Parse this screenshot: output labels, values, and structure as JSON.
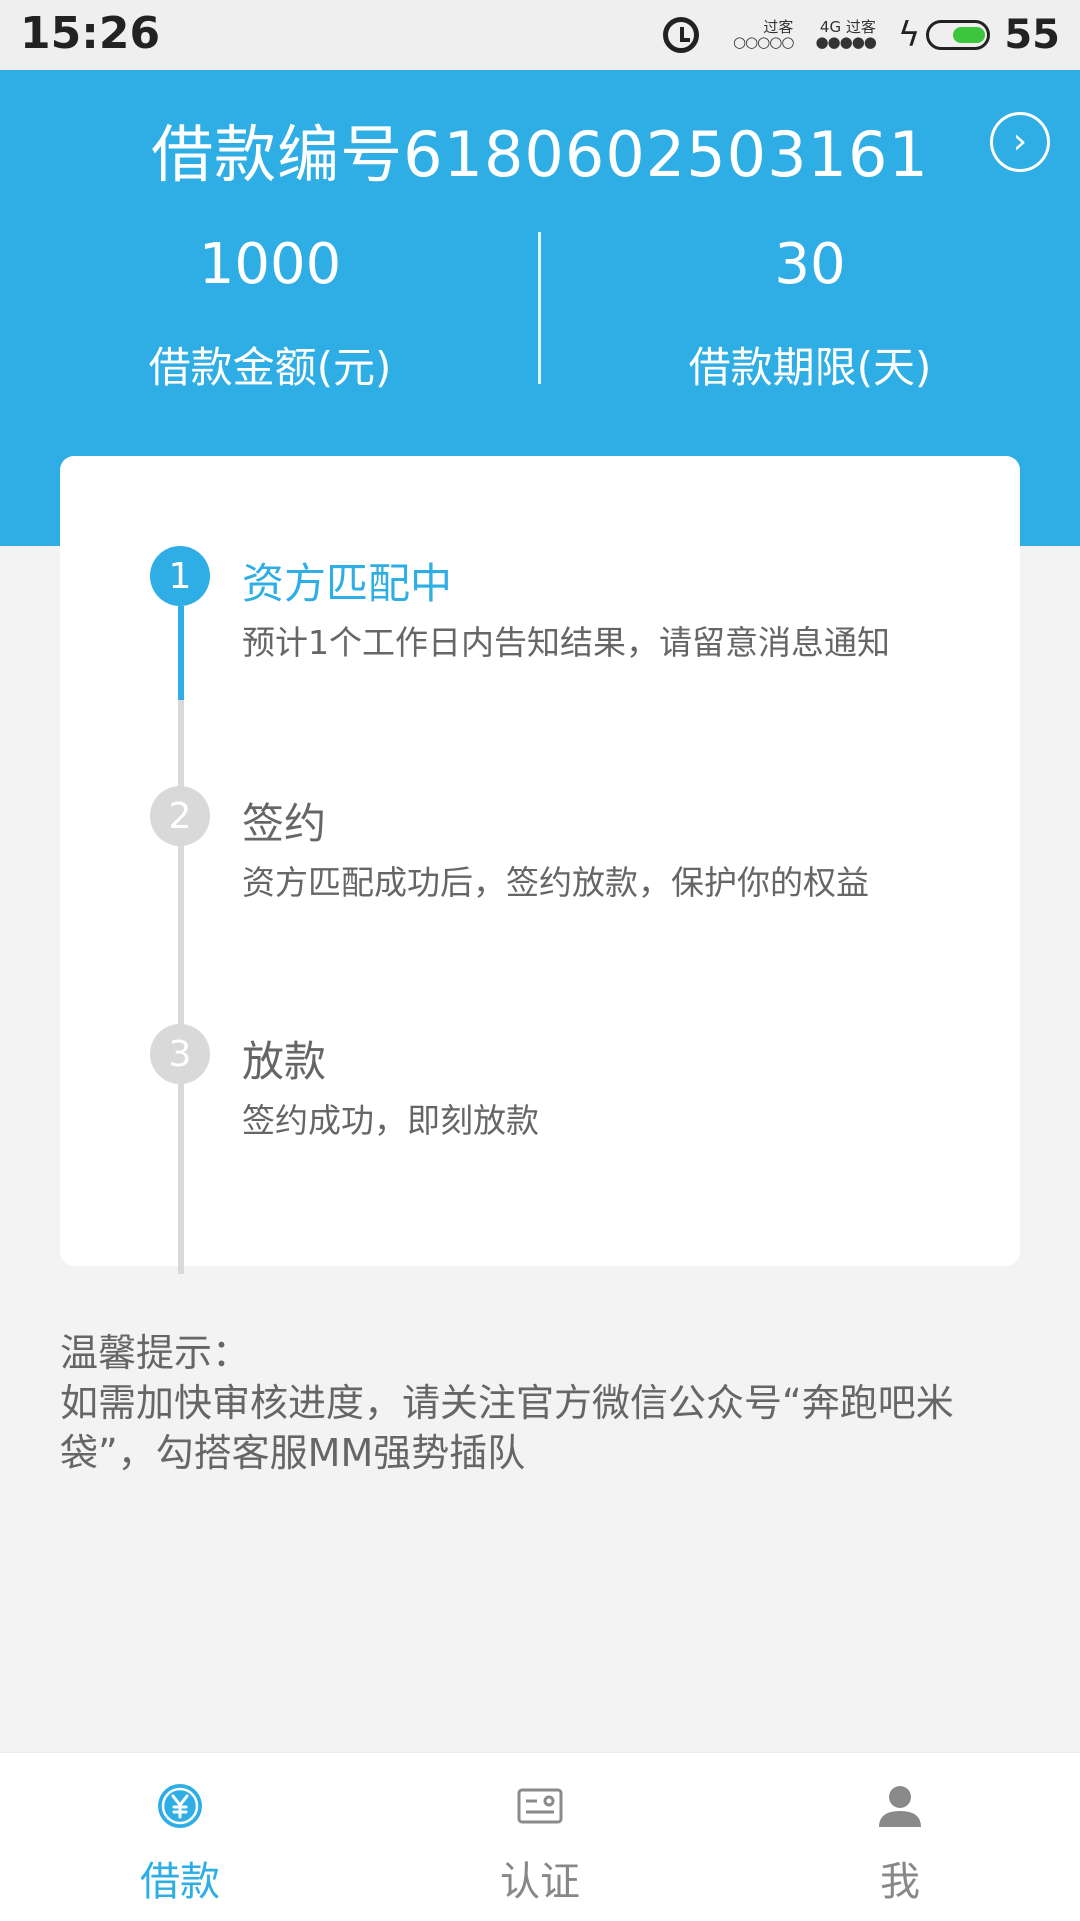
{
  "status_bar": {
    "time": "15:26",
    "sim1_label": "过客",
    "sim1_signal": "○○○○○",
    "sim2_network": "4G",
    "sim2_label": "过客",
    "sim2_signal": "●●●●●",
    "battery_level": "55"
  },
  "loan": {
    "title": "借款编号6180602503161",
    "amount_value": "1000",
    "amount_label": "借款金额(元)",
    "term_value": "30",
    "term_label": "借款期限(天)"
  },
  "steps": [
    {
      "number": "1",
      "title": "资方匹配中",
      "desc": "预计1个工作日内告知结果，请留意消息通知",
      "state": "active"
    },
    {
      "number": "2",
      "title": "签约",
      "desc": "资方匹配成功后，签约放款，保护你的权益",
      "state": "pending"
    },
    {
      "number": "3",
      "title": "放款",
      "desc": "签约成功，即刻放款",
      "state": "pending"
    }
  ],
  "tips": {
    "heading": "温馨提示：",
    "body": "如需加快审核进度，请关注官方微信公众号“奔跑吧米袋”，勾搭客服MM强势插队"
  },
  "tabs": [
    {
      "label": "借款",
      "icon": "yuan-icon",
      "active": true
    },
    {
      "label": "认证",
      "icon": "id-card-icon",
      "active": false
    },
    {
      "label": "我",
      "icon": "user-icon",
      "active": false
    }
  ],
  "colors": {
    "accent": "#2eaee5",
    "inactive": "#d9d9d9",
    "text_gray": "#666666",
    "background": "#f3f3f3"
  }
}
